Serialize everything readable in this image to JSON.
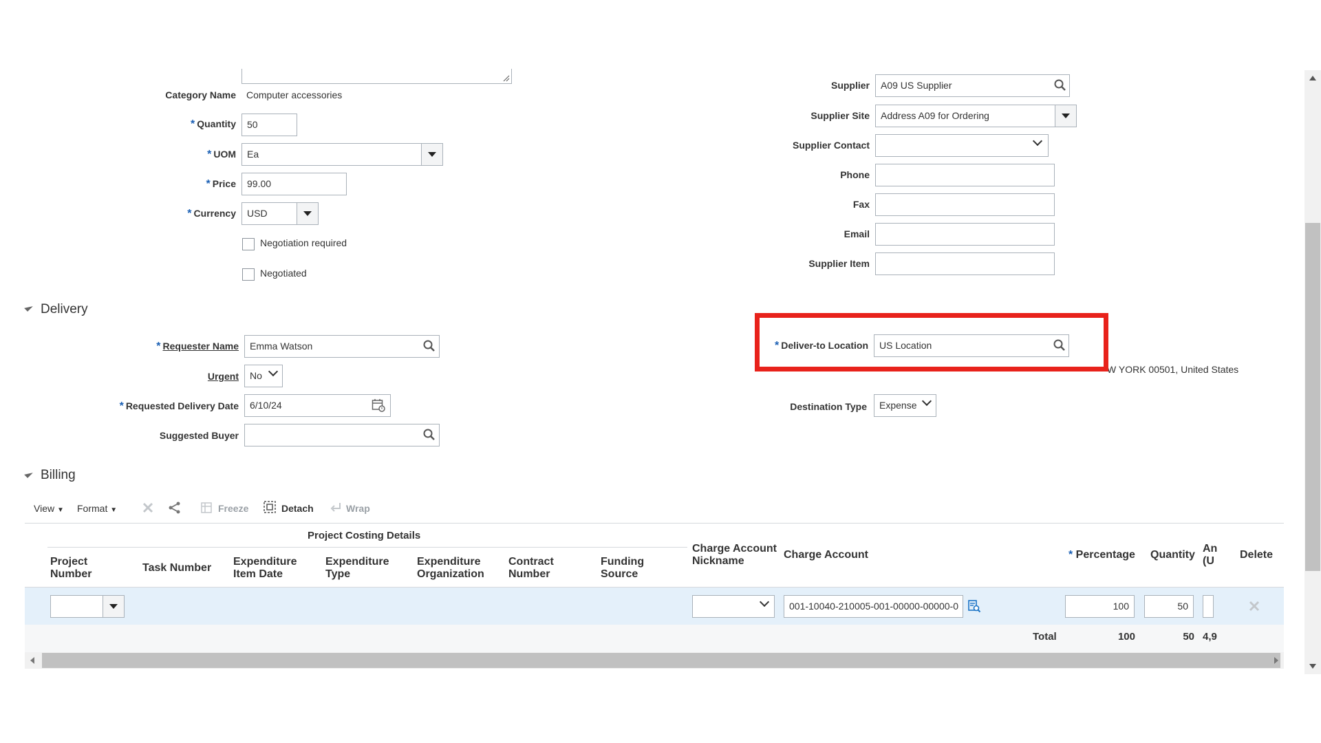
{
  "item": {
    "category_label": "Category Name",
    "category_value": "Computer accessories",
    "quantity_label": "Quantity",
    "quantity_value": "50",
    "uom_label": "UOM",
    "uom_value": "Ea",
    "price_label": "Price",
    "price_value": "99.00",
    "currency_label": "Currency",
    "currency_value": "USD",
    "negotiation_required_label": "Negotiation required",
    "negotiated_label": "Negotiated"
  },
  "supplier": {
    "supplier_label": "Supplier",
    "supplier_value": "A09 US Supplier",
    "site_label": "Supplier Site",
    "site_value": "Address A09 for Ordering",
    "contact_label": "Supplier Contact",
    "contact_value": "",
    "phone_label": "Phone",
    "fax_label": "Fax",
    "email_label": "Email",
    "item_label": "Supplier Item"
  },
  "delivery": {
    "section_title": "Delivery",
    "requester_label": "Requester Name",
    "requester_value": "Emma Watson",
    "urgent_label": "Urgent",
    "urgent_value": "No",
    "date_label": "Requested Delivery Date",
    "date_value": "6/10/24",
    "buyer_label": "Suggested Buyer",
    "buyer_value": "",
    "deliver_to_label": "Deliver-to Location",
    "deliver_to_value": "US  Location",
    "deliver_address_visible": "W YORK 00501, United States",
    "destination_label": "Destination Type",
    "destination_value": "Expense",
    "highlight_color": "#e8221b"
  },
  "billing": {
    "section_title": "Billing",
    "toolbar": {
      "view": "View",
      "format": "Format",
      "freeze": "Freeze",
      "detach": "Detach",
      "wrap": "Wrap"
    },
    "group_header": "Project Costing Details",
    "columns": {
      "project_number": "Project Number",
      "task_number": "Task Number",
      "expenditure_item_date": "Expenditure Item Date",
      "expenditure_type": "Expenditure Type",
      "expenditure_org": "Expenditure Organization",
      "contract_number": "Contract Number",
      "funding_source": "Funding Source",
      "charge_account_nickname": "Charge Account Nickname",
      "charge_account": "Charge Account",
      "percentage": "Percentage",
      "quantity": "Quantity",
      "amount": "An (U",
      "delete": "Delete"
    },
    "row": {
      "charge_account": "001-10040-210005-001-00000-00000-0",
      "percentage": "100",
      "quantity": "50"
    },
    "totals": {
      "label": "Total",
      "percentage": "100",
      "quantity": "50",
      "amount": "4,9"
    }
  }
}
